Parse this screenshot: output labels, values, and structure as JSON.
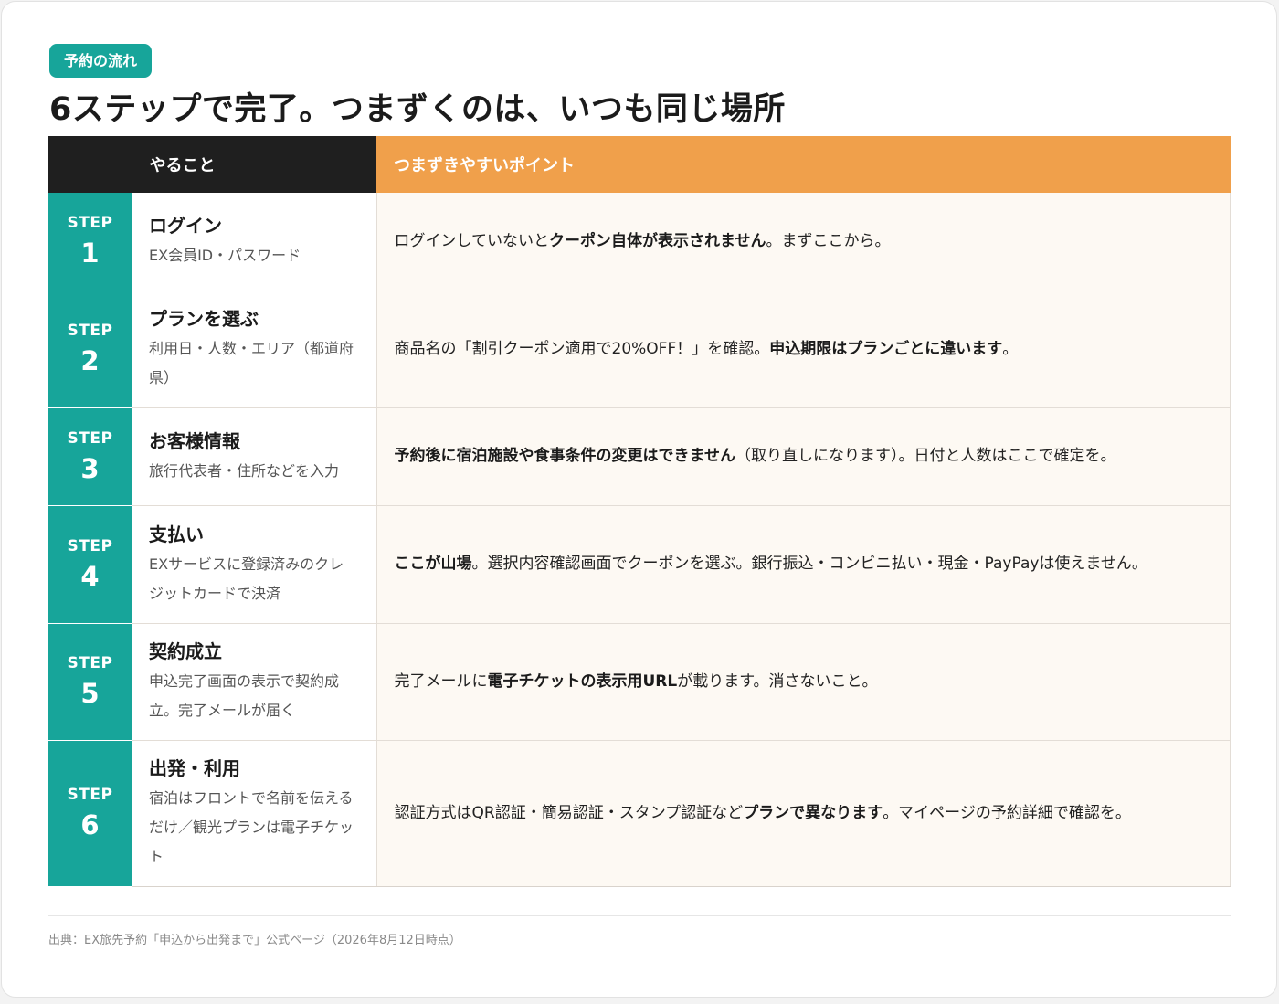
{
  "badge": "予約の流れ",
  "title": "6ステップで完了。つまずくのは、いつも同じ場所",
  "table": {
    "headers": {
      "step": "",
      "what": "やること",
      "point": "つまずきやすいポイント"
    },
    "rows": [
      {
        "step_label": "STEP",
        "step_num": "1",
        "title": "ログイン",
        "sub": "EX会員ID・パスワード",
        "point": [
          {
            "t": "ログインしていないと"
          },
          {
            "t": "クーポン自体が表示されません",
            "b": true
          },
          {
            "t": "。まずここから。"
          }
        ]
      },
      {
        "step_label": "STEP",
        "step_num": "2",
        "title": "プランを選ぶ",
        "sub": "利用日・人数・エリア（都道府県）",
        "point": [
          {
            "t": "商品名の「割引クーポン適用で20%OFF！」を確認。"
          },
          {
            "t": "申込期限はプランごとに違います",
            "b": true
          },
          {
            "t": "。"
          }
        ]
      },
      {
        "step_label": "STEP",
        "step_num": "3",
        "title": "お客様情報",
        "sub": "旅行代表者・住所などを入力",
        "point": [
          {
            "t": "予約後に宿泊施設や食事条件の変更はできません",
            "b": true
          },
          {
            "t": "（取り直しになります）。日付と人数はここで確定を。"
          }
        ]
      },
      {
        "step_label": "STEP",
        "step_num": "4",
        "title": "支払い",
        "sub": "EXサービスに登録済みのクレジットカードで決済",
        "point": [
          {
            "t": "ここが山場",
            "b": true
          },
          {
            "t": "。選択内容確認画面でクーポンを選ぶ。銀行振込・コンビニ払い・現金・PayPayは使えません。"
          }
        ]
      },
      {
        "step_label": "STEP",
        "step_num": "5",
        "title": "契約成立",
        "sub": "申込完了画面の表示で契約成立。完了メールが届く",
        "point": [
          {
            "t": "完了メールに"
          },
          {
            "t": "電子チケットの表示用URL",
            "b": true
          },
          {
            "t": "が載ります。消さないこと。"
          }
        ]
      },
      {
        "step_label": "STEP",
        "step_num": "6",
        "title": "出発・利用",
        "sub": "宿泊はフロントで名前を伝えるだけ／観光プランは電子チケット",
        "point": [
          {
            "t": "認証方式はQR認証・簡易認証・スタンプ認証など"
          },
          {
            "t": "プランで異なります",
            "b": true
          },
          {
            "t": "。マイページの予約詳細で確認を。"
          }
        ]
      }
    ]
  },
  "source": "出典：EX旅先予約「申込から出発まで」公式ページ（2026年8月12日時点）"
}
